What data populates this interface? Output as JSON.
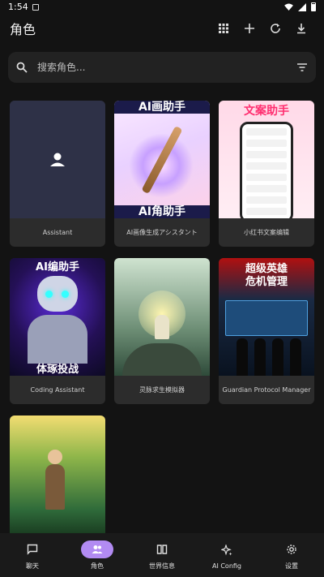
{
  "status_bar": {
    "time": "1:54"
  },
  "app_bar": {
    "title": "角色"
  },
  "search": {
    "placeholder": "搜索角色..."
  },
  "characters": [
    {
      "name": "Assistant"
    },
    {
      "name": "AI画像生成アシスタント",
      "banner_top": "AI画助手",
      "banner_bottom": "AI角助手"
    },
    {
      "name": "小红书文案编辑",
      "banner_top": "文案助手"
    },
    {
      "name": "Coding Assistant",
      "banner_top": "AI编助手",
      "banner_bottom": "体琢投战"
    },
    {
      "name": "灵脉求生模拟器"
    },
    {
      "name": "Guardian Protocol Manager",
      "banner_top": "超级英雄",
      "banner_bottom": "危机管理"
    },
    {
      "name": ""
    }
  ],
  "bottom_nav": [
    {
      "label": "聊天",
      "icon": "chat-icon",
      "active": false
    },
    {
      "label": "角色",
      "icon": "people-icon",
      "active": true
    },
    {
      "label": "世界信息",
      "icon": "book-icon",
      "active": false
    },
    {
      "label": "AI Config",
      "icon": "sparkle-icon",
      "active": false
    },
    {
      "label": "设置",
      "icon": "gear-icon",
      "active": false
    }
  ],
  "colors": {
    "accent": "#b28bf2",
    "background": "#131313",
    "card": "#2c2c2c"
  }
}
